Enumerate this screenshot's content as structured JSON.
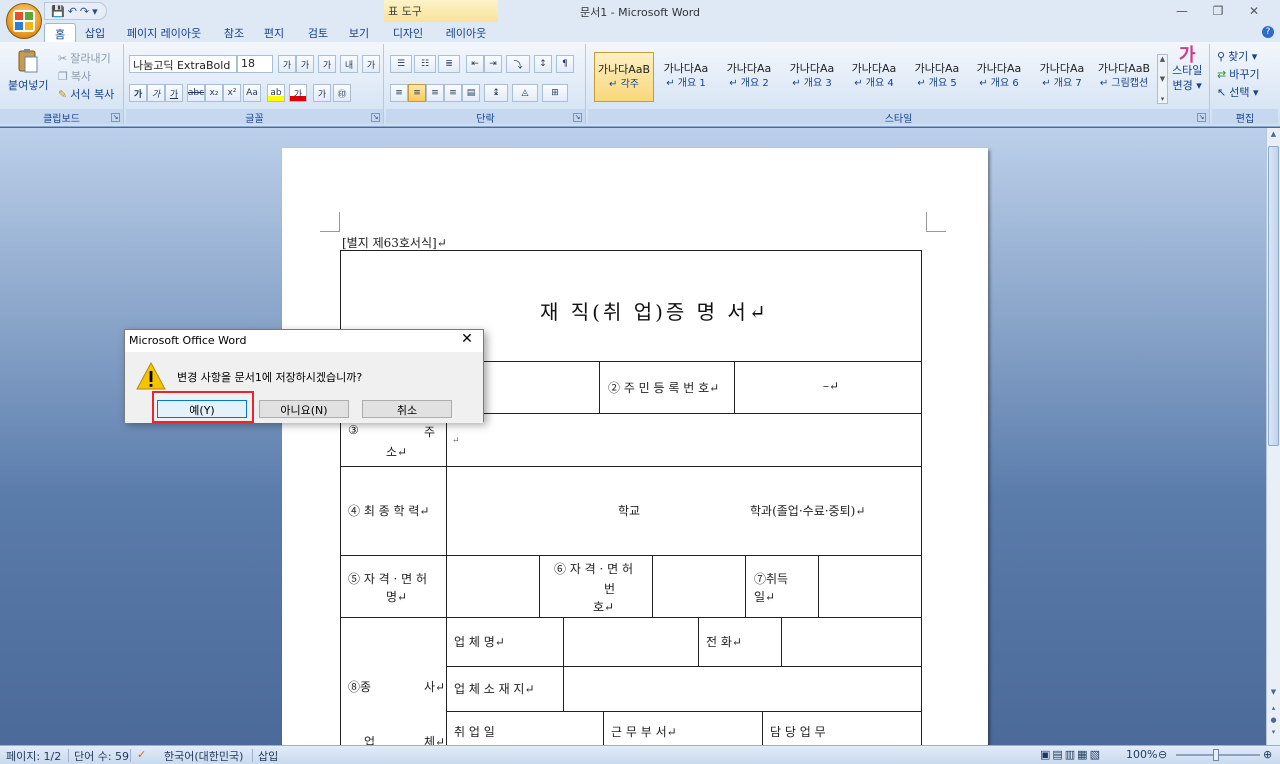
{
  "window": {
    "title": "문서1 - Microsoft Word",
    "context_tab_group": "표 도구",
    "controls": {
      "minimize": "—",
      "restore": "❐",
      "close": "✕"
    }
  },
  "quick_access": {
    "save": "💾",
    "undo": "↶",
    "redo": "↷",
    "customize": "▾"
  },
  "tabs": [
    "홈",
    "삽입",
    "페이지 레이아웃",
    "참조",
    "편지",
    "검토",
    "보기",
    "디자인",
    "레이아웃"
  ],
  "ribbon": {
    "clipboard": {
      "paste": "붙여넣기",
      "cut": "잘라내기",
      "copy": "복사",
      "format_painter": "서식 복사",
      "label": "클립보드"
    },
    "font": {
      "name": "나눔고딕 ExtraBold",
      "size": "18",
      "label": "글꼴",
      "grow": "가",
      "shrink": "가",
      "clear": "가",
      "phonetic": "내",
      "border": "가",
      "bold": "가",
      "italic": "가",
      "underline": "가",
      "strike": "abc",
      "subscript": "x₂",
      "superscript": "x²",
      "case": "Aa",
      "highlight": "ab",
      "color": "가",
      "shade": "가",
      "enclose": "㊞"
    },
    "paragraph": {
      "label": "단락"
    },
    "styles": {
      "label": "스타일",
      "items": [
        {
          "sample": "가나다AaB",
          "name": "↵ 각주"
        },
        {
          "sample": "가나다Aa",
          "name": "↵ 개요 1"
        },
        {
          "sample": "가나다Aa",
          "name": "↵ 개요 2"
        },
        {
          "sample": "가나다Aa",
          "name": "↵ 개요 3"
        },
        {
          "sample": "가나다Aa",
          "name": "↵ 개요 4"
        },
        {
          "sample": "가나다Aa",
          "name": "↵ 개요 5"
        },
        {
          "sample": "가나다Aa",
          "name": "↵ 개요 6"
        },
        {
          "sample": "가나다Aa",
          "name": "↵ 개요 7"
        },
        {
          "sample": "가나다AaB",
          "name": "↵ 그림캡션"
        }
      ],
      "change_styles_line1": "스타일",
      "change_styles_line2": "변경 ▾"
    },
    "editing": {
      "label": "편집",
      "find": "찾기 ▾",
      "replace": "바꾸기",
      "select": "선택 ▾"
    }
  },
  "document": {
    "form_no": "[별지  제63호서식]↵",
    "title": "재 직(취 업)증 명 서↵",
    "rows": {
      "rrn_label": "② 주 민 등 록 번 호↵",
      "rrn_value": "–↵",
      "address_label_a": "③",
      "address_label_b": "주",
      "address_label_c": "소↵",
      "education_label": "④ 최 종 학 력↵",
      "school": "학교",
      "major": "학과(졸업·수료·중퇴)↵",
      "license_label_a": "⑤ 자 격 · 면 허",
      "license_label_b": "명↵",
      "license_no_a": "⑥ 자 격 · 면 허",
      "license_no_b": "번",
      "license_no_c": "호↵",
      "acquired_a": "⑦취득",
      "acquired_b": "일↵",
      "company_label": "업    체    명↵",
      "phone_label": "전        화↵",
      "company_addr_label": "업 체 소 재 지↵",
      "career_label_a": "⑧종",
      "career_label_b": "사↵",
      "career_label_c": "업",
      "career_label_d": "체↵",
      "employ_date_label": "취       업       일",
      "dept_label": "근    무    부    서↵",
      "duty_label": "담    당    업    무",
      "para": "↵"
    }
  },
  "dialog": {
    "title": "Microsoft Office Word",
    "close": "✕",
    "message": "변경 사항을 문서1에 저장하시겠습니까?",
    "yes": "예(Y)",
    "no": "아니요(N)",
    "cancel": "취소"
  },
  "status": {
    "page": "페이지: 1/2",
    "words": "단어 수: 59",
    "language": "한국어(대한민국)",
    "mode": "삽입",
    "zoom": "100%"
  },
  "colors": {
    "highlight_box": "#e8262f",
    "ribbon": "#dbe7f5",
    "doc_background": "#4a6a96"
  }
}
